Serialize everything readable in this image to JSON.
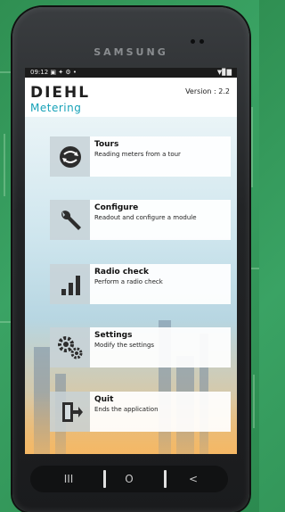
{
  "device": {
    "brand": "SAMSUNG"
  },
  "status_bar": {
    "time": "09:12",
    "left_icons": "▣ ✦ ⚙ •",
    "right_icons": "▼▊▇"
  },
  "header": {
    "logo_main": "DIEHL",
    "logo_sub": "Metering",
    "version": "Version : 2.2"
  },
  "menu": [
    {
      "title": "Tours",
      "description": "Reading meters from a tour",
      "icon": "globe-arrows-icon"
    },
    {
      "title": "Configure",
      "description": "Readout and configure a module",
      "icon": "wrench-icon"
    },
    {
      "title": "Radio check",
      "description": "Perform a radio check",
      "icon": "signal-bars-icon"
    },
    {
      "title": "Settings",
      "description": "Modify the settings",
      "icon": "gears-icon"
    },
    {
      "title": "Quit",
      "description": "Ends the application",
      "icon": "exit-door-icon"
    }
  ],
  "navbar": {
    "recents": "III",
    "home": "O",
    "back": "<"
  },
  "colors": {
    "metering_accent": "#17a2b8",
    "pcb_background": "#2f8f52",
    "device_body": "#222426"
  }
}
